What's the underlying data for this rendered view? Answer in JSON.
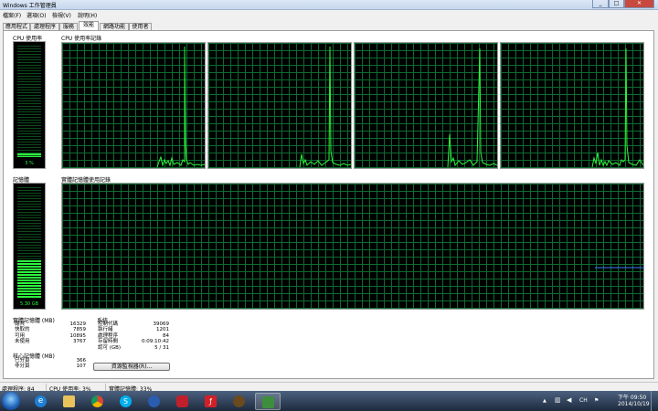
{
  "window": {
    "title": "Windows 工作管理員"
  },
  "menu": [
    "檔案(F)",
    "選項(O)",
    "檢視(V)",
    "說明(H)"
  ],
  "tabs": [
    "應用程式",
    "處理程序",
    "服務",
    "效能",
    "網路功能",
    "使用者"
  ],
  "active_tab": "效能",
  "cpu": {
    "meter_label": "CPU 使用率",
    "meter_value": "3 %",
    "meter_level": 0.03,
    "history_label": "CPU 使用率記錄",
    "core_count": 4
  },
  "memory": {
    "meter_label": "記憶體",
    "meter_value": "5.30 GB",
    "meter_level": 0.33,
    "history_label": "實體記憶體使用記錄"
  },
  "physical_memory": {
    "heading": "實體記憶體 (MB)",
    "rows": [
      {
        "label": "總共",
        "value": "16329"
      },
      {
        "label": "快取的",
        "value": "7859"
      },
      {
        "label": "可用",
        "value": "10895"
      },
      {
        "label": "未使用",
        "value": "3767"
      }
    ]
  },
  "kernel_memory": {
    "heading": "核心記憶體 (MB)",
    "rows": [
      {
        "label": "已分頁",
        "value": "366"
      },
      {
        "label": "非分頁",
        "value": "107"
      }
    ]
  },
  "system": {
    "heading": "系統",
    "rows": [
      {
        "label": "控制代碼",
        "value": "39069"
      },
      {
        "label": "執行緒",
        "value": "1201"
      },
      {
        "label": "處理程序",
        "value": "84"
      },
      {
        "label": "存留時間",
        "value": "0:09:10:42"
      },
      {
        "label": "認可 (GB)",
        "value": "5 / 31"
      }
    ]
  },
  "resource_monitor_button": "資源監視器(R)...",
  "status": {
    "processes": "處理程序: 84",
    "cpu": "CPU 使用率: 3%",
    "memory": "實體記憶體: 33%"
  },
  "taskbar": {
    "icons": [
      "ie-icon",
      "folder-icon",
      "chrome-icon",
      "skype-icon",
      "player-icon",
      "bag-icon",
      "flash-icon",
      "game-icon",
      "task-manager-icon"
    ],
    "language": "CH",
    "time": "下午 09:50",
    "date": "2014/10/19"
  },
  "colors": {
    "graph_line": "#2cf53c",
    "grid": "#0e6b31",
    "memory_line": "#3b7bff"
  }
}
